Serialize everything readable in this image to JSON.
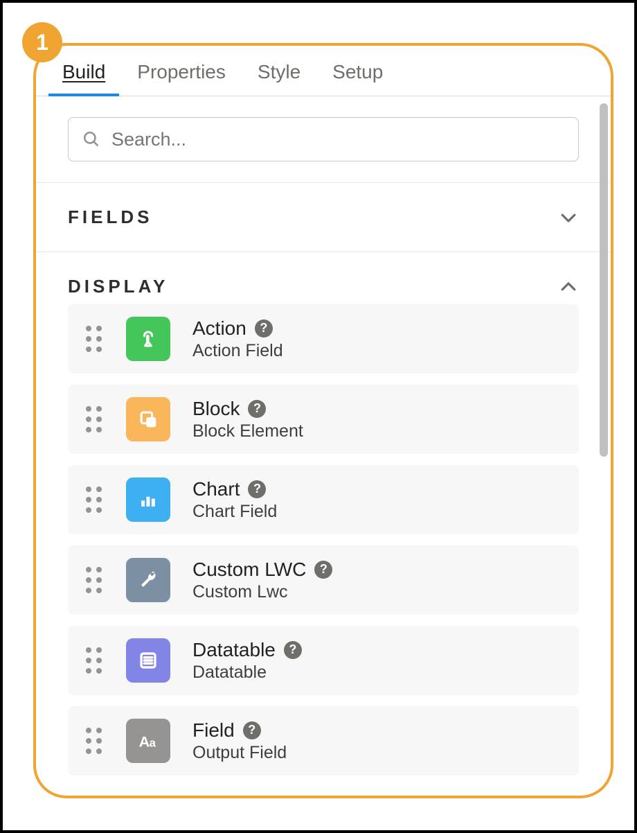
{
  "callout": {
    "number": "1"
  },
  "tabs": [
    {
      "label": "Build",
      "active": true
    },
    {
      "label": "Properties",
      "active": false
    },
    {
      "label": "Style",
      "active": false
    },
    {
      "label": "Setup",
      "active": false
    }
  ],
  "search": {
    "placeholder": "Search..."
  },
  "sections": {
    "fields": {
      "title": "FIELDS",
      "expanded": false
    },
    "display": {
      "title": "DISPLAY",
      "expanded": true
    }
  },
  "display_items": [
    {
      "title": "Action",
      "subtitle": "Action Field",
      "icon": "touch",
      "color": "green"
    },
    {
      "title": "Block",
      "subtitle": "Block Element",
      "icon": "copy",
      "color": "orange"
    },
    {
      "title": "Chart",
      "subtitle": "Chart Field",
      "icon": "chart",
      "color": "blue"
    },
    {
      "title": "Custom LWC",
      "subtitle": "Custom Lwc",
      "icon": "wrench",
      "color": "slate"
    },
    {
      "title": "Datatable",
      "subtitle": "Datatable",
      "icon": "list",
      "color": "violet"
    },
    {
      "title": "Field",
      "subtitle": "Output Field",
      "icon": "aa",
      "color": "gray"
    }
  ],
  "help_glyph": "?"
}
